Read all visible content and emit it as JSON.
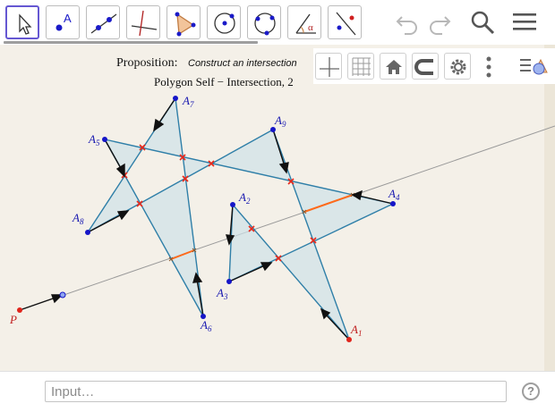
{
  "toolbar": {
    "tools": [
      {
        "name": "Move",
        "icon": "arrow-cursor-icon"
      },
      {
        "name": "Point",
        "icon": "point-icon",
        "glyph": "A"
      },
      {
        "name": "Line",
        "icon": "line-through-points-icon"
      },
      {
        "name": "Perpendicular Line",
        "icon": "perpendicular-line-icon"
      },
      {
        "name": "Polygon",
        "icon": "polygon-icon"
      },
      {
        "name": "Circle with Center through Point",
        "icon": "circle-center-point-icon"
      },
      {
        "name": "Circle through 3 Points",
        "icon": "circle-three-points-icon"
      },
      {
        "name": "Angle",
        "icon": "angle-icon",
        "glyph": "α"
      },
      {
        "name": "Reflect about Line",
        "icon": "reflect-line-icon"
      }
    ],
    "undo_icon": "undo-icon",
    "redo_icon": "redo-icon",
    "search_icon": "search-icon",
    "menu_icon": "hamburger-menu-icon"
  },
  "graphics_bar": {
    "buttons": [
      "axes-icon",
      "grid-icon",
      "home-icon",
      "point-capturing-icon",
      "settings-gear-icon",
      "more-vertical-icon"
    ],
    "style_bar_icon": "style-bar-toggle-icon"
  },
  "canvas": {
    "proposition_label": "Proposition:",
    "proposition_text": "Construct an intersection",
    "subtitle": "Polygon Self − Intersection, 2",
    "points": {
      "A1": "A1",
      "A2": "A2",
      "A3": "A3",
      "A4": "A4",
      "A5": "A5",
      "A6": "A6",
      "A7": "A7",
      "A8": "A8",
      "A9": "A9",
      "P": "P"
    }
  },
  "input_bar": {
    "placeholder": "Input…",
    "help_label": "?"
  },
  "colors": {
    "selected_tool_border": "#6557d2",
    "polygon_edge": "#2f7fa8",
    "polygon_fill": "#d6e6ec",
    "intersection_mark": "#e8281a",
    "highlight_segment": "#ff6a1a",
    "point_blue": "#1515c8",
    "point_red": "#e0251c",
    "canvas_bg": "#f4f0e8"
  }
}
